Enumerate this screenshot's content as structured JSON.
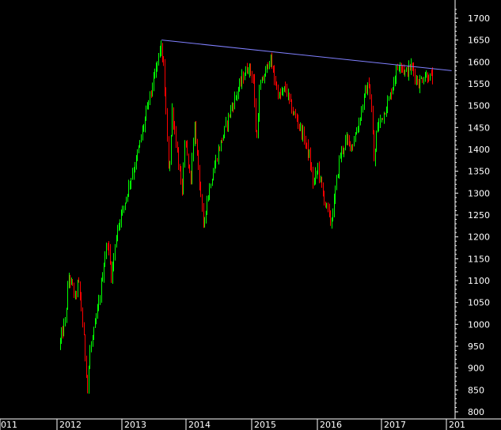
{
  "chart_data": {
    "type": "candlestick",
    "x_tick_labels": [
      "011",
      "2012",
      "2013",
      "2014",
      "2015",
      "2016",
      "2017",
      "201"
    ],
    "y_tick_labels": [
      "800",
      "850",
      "900",
      "950",
      "1000",
      "1050",
      "1100",
      "1150",
      "1200",
      "1250",
      "1300",
      "1350",
      "1400",
      "1450",
      "1500",
      "1550",
      "1600",
      "1650",
      "1700"
    ],
    "ylim": [
      790,
      1730
    ],
    "xlim": [
      2011.85,
      2018.75
    ],
    "grid": false,
    "colors": {
      "background": "#000000",
      "up": "#00ff00",
      "down": "#ff0000",
      "axis": "#ffffff",
      "trendline": "#8080ff"
    },
    "price_path": [
      [
        2011.85,
        950
      ],
      [
        2011.95,
        1010
      ],
      [
        2012.0,
        1110
      ],
      [
        2012.05,
        1090
      ],
      [
        2012.1,
        1060
      ],
      [
        2012.15,
        1100
      ],
      [
        2012.2,
        1030
      ],
      [
        2012.27,
        900
      ],
      [
        2012.29,
        850
      ],
      [
        2012.33,
        940
      ],
      [
        2012.4,
        990
      ],
      [
        2012.48,
        1060
      ],
      [
        2012.55,
        1150
      ],
      [
        2012.6,
        1190
      ],
      [
        2012.66,
        1110
      ],
      [
        2012.75,
        1220
      ],
      [
        2012.85,
        1270
      ],
      [
        2012.95,
        1330
      ],
      [
        2013.05,
        1380
      ],
      [
        2013.15,
        1450
      ],
      [
        2013.25,
        1520
      ],
      [
        2013.32,
        1560
      ],
      [
        2013.42,
        1640
      ],
      [
        2013.47,
        1580
      ],
      [
        2013.55,
        1340
      ],
      [
        2013.6,
        1490
      ],
      [
        2013.68,
        1390
      ],
      [
        2013.75,
        1300
      ],
      [
        2013.8,
        1420
      ],
      [
        2013.88,
        1330
      ],
      [
        2013.95,
        1450
      ],
      [
        2014.0,
        1370
      ],
      [
        2014.05,
        1280
      ],
      [
        2014.08,
        1220
      ],
      [
        2014.12,
        1270
      ],
      [
        2014.2,
        1330
      ],
      [
        2014.3,
        1390
      ],
      [
        2014.4,
        1440
      ],
      [
        2014.5,
        1490
      ],
      [
        2014.6,
        1530
      ],
      [
        2014.7,
        1570
      ],
      [
        2014.78,
        1590
      ],
      [
        2014.85,
        1560
      ],
      [
        2014.9,
        1410
      ],
      [
        2014.95,
        1540
      ],
      [
        2015.05,
        1580
      ],
      [
        2015.1,
        1610
      ],
      [
        2015.15,
        1580
      ],
      [
        2015.25,
        1520
      ],
      [
        2015.35,
        1540
      ],
      [
        2015.45,
        1490
      ],
      [
        2015.55,
        1460
      ],
      [
        2015.65,
        1420
      ],
      [
        2015.72,
        1380
      ],
      [
        2015.78,
        1320
      ],
      [
        2015.85,
        1360
      ],
      [
        2015.92,
        1300
      ],
      [
        2016.0,
        1260
      ],
      [
        2016.05,
        1230
      ],
      [
        2016.1,
        1280
      ],
      [
        2016.18,
        1380
      ],
      [
        2016.28,
        1420
      ],
      [
        2016.38,
        1410
      ],
      [
        2016.48,
        1460
      ],
      [
        2016.58,
        1530
      ],
      [
        2016.64,
        1550
      ],
      [
        2016.68,
        1480
      ],
      [
        2016.72,
        1360
      ],
      [
        2016.76,
        1450
      ],
      [
        2016.86,
        1480
      ],
      [
        2016.96,
        1520
      ],
      [
        2017.06,
        1580
      ],
      [
        2017.12,
        1600
      ],
      [
        2017.2,
        1575
      ],
      [
        2017.3,
        1590
      ],
      [
        2017.4,
        1550
      ],
      [
        2017.5,
        1570
      ],
      [
        2017.6,
        1565
      ]
    ],
    "trendline": {
      "from": [
        2013.42,
        1650
      ],
      "to": [
        2017.9,
        1580
      ]
    }
  }
}
